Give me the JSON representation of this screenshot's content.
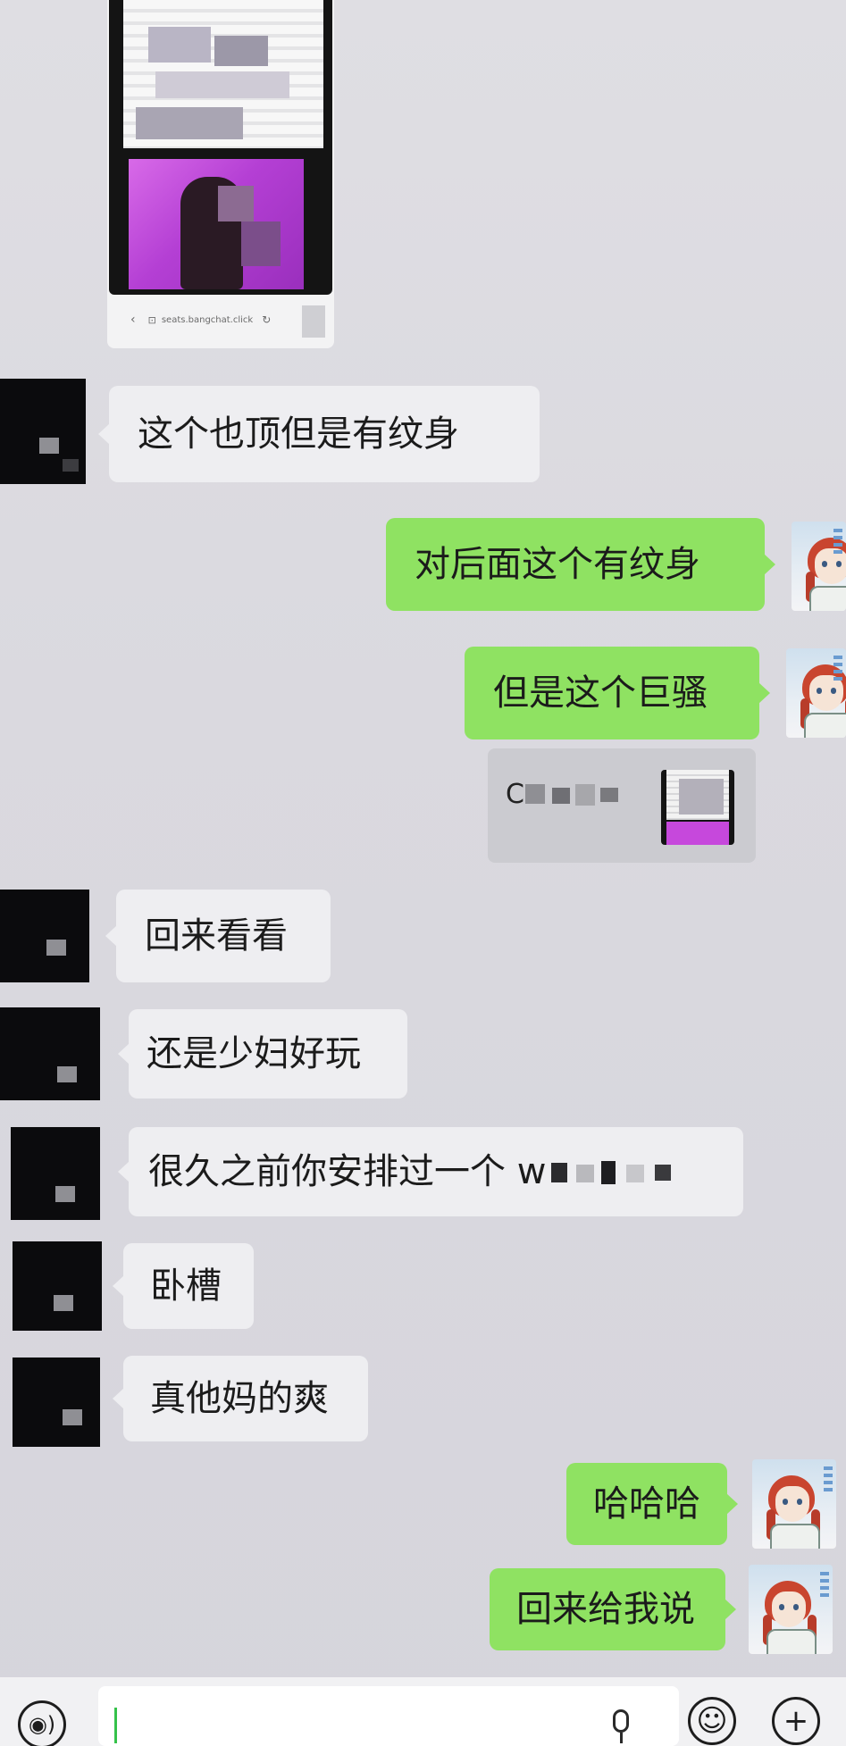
{
  "chat": {
    "screenshot_message": {
      "url_text": "seats.bangchat.click",
      "back_glyph": "‹",
      "lock_glyph": "⊡",
      "reload_glyph": "↻"
    },
    "messages": [
      {
        "side": "in",
        "text": "这个也顶但是有纹身"
      },
      {
        "side": "out",
        "text": "对后面这个有纹身"
      },
      {
        "side": "out",
        "text": "但是这个巨骚"
      },
      {
        "side": "in",
        "text": "回来看看"
      },
      {
        "side": "in",
        "text": "还是少妇好玩"
      },
      {
        "side": "in",
        "text": "很久之前你安排过一个 w"
      },
      {
        "side": "in",
        "text": "卧槽"
      },
      {
        "side": "in",
        "text": "真他妈的爽"
      },
      {
        "side": "out",
        "text": "哈哈哈"
      },
      {
        "side": "out",
        "text": "回来给我说"
      }
    ],
    "link_card": {
      "title_prefix": "C"
    }
  },
  "input_bar": {
    "voice_icon": "voice-toggle-icon",
    "voice_glyph": "◉)",
    "emoji_glyph": "☺",
    "plus_glyph": "+"
  },
  "colors": {
    "outgoing_bubble": "#8fe262",
    "incoming_bubble": "#eeeef1",
    "background": "#dad9df"
  }
}
